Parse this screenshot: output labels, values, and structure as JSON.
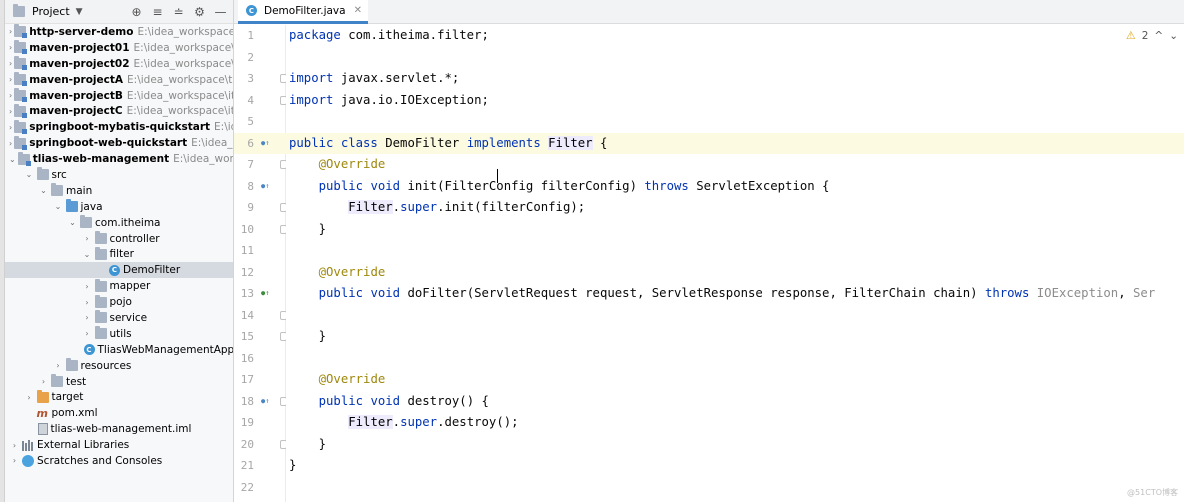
{
  "project_panel": {
    "title": "Project",
    "tree": [
      {
        "label": "http-server-demo",
        "path": "E:\\idea_workspace\\ithe",
        "type": "module",
        "indent": 0,
        "arrow": "›",
        "bold": true
      },
      {
        "label": "maven-project01",
        "path": "E:\\idea_workspace\\ith",
        "type": "module",
        "indent": 0,
        "arrow": "›",
        "bold": true
      },
      {
        "label": "maven-project02",
        "path": "E:\\idea_workspace\\ithe",
        "type": "module",
        "indent": 0,
        "arrow": "›",
        "bold": true
      },
      {
        "label": "maven-projectA",
        "path": "E:\\idea_workspace\\thei",
        "type": "module",
        "indent": 0,
        "arrow": "›",
        "bold": true
      },
      {
        "label": "maven-projectB",
        "path": "E:\\idea_workspace\\ithei",
        "type": "module",
        "indent": 0,
        "arrow": "›",
        "bold": true
      },
      {
        "label": "maven-projectC",
        "path": "E:\\idea_workspace\\ithei",
        "type": "module",
        "indent": 0,
        "arrow": "›",
        "bold": true
      },
      {
        "label": "springboot-mybatis-quickstart",
        "path": "E:\\idea_w",
        "type": "module",
        "indent": 0,
        "arrow": "›",
        "bold": true
      },
      {
        "label": "springboot-web-quickstart",
        "path": "E:\\idea_work",
        "type": "module",
        "indent": 0,
        "arrow": "›",
        "bold": true
      },
      {
        "label": "tlias-web-management",
        "path": "E:\\idea_workspa",
        "type": "module",
        "indent": 0,
        "arrow": "⌄",
        "bold": true
      },
      {
        "label": "src",
        "path": "",
        "type": "folder",
        "indent": 1,
        "arrow": "⌄",
        "bold": false
      },
      {
        "label": "main",
        "path": "",
        "type": "folder",
        "indent": 2,
        "arrow": "⌄",
        "bold": false
      },
      {
        "label": "java",
        "path": "",
        "type": "folder-blue",
        "indent": 3,
        "arrow": "⌄",
        "bold": false
      },
      {
        "label": "com.itheima",
        "path": "",
        "type": "folder",
        "indent": 4,
        "arrow": "⌄",
        "bold": false
      },
      {
        "label": "controller",
        "path": "",
        "type": "folder",
        "indent": 5,
        "arrow": "›",
        "bold": false
      },
      {
        "label": "filter",
        "path": "",
        "type": "folder",
        "indent": 5,
        "arrow": "⌄",
        "bold": false
      },
      {
        "label": "DemoFilter",
        "path": "",
        "type": "class",
        "indent": 6,
        "arrow": "",
        "bold": false,
        "selected": true
      },
      {
        "label": "mapper",
        "path": "",
        "type": "folder",
        "indent": 5,
        "arrow": "›",
        "bold": false
      },
      {
        "label": "pojo",
        "path": "",
        "type": "folder",
        "indent": 5,
        "arrow": "›",
        "bold": false
      },
      {
        "label": "service",
        "path": "",
        "type": "folder",
        "indent": 5,
        "arrow": "›",
        "bold": false
      },
      {
        "label": "utils",
        "path": "",
        "type": "folder",
        "indent": 5,
        "arrow": "›",
        "bold": false
      },
      {
        "label": "TliasWebManagementApp",
        "path": "",
        "type": "class",
        "indent": 5,
        "arrow": "",
        "bold": false
      },
      {
        "label": "resources",
        "path": "",
        "type": "folder",
        "indent": 3,
        "arrow": "›",
        "bold": false
      },
      {
        "label": "test",
        "path": "",
        "type": "folder",
        "indent": 2,
        "arrow": "›",
        "bold": false
      },
      {
        "label": "target",
        "path": "",
        "type": "folder-orange",
        "indent": 1,
        "arrow": "›",
        "bold": false
      },
      {
        "label": "pom.xml",
        "path": "",
        "type": "maven",
        "indent": 1,
        "arrow": "",
        "bold": false
      },
      {
        "label": "tlias-web-management.iml",
        "path": "",
        "type": "iml",
        "indent": 1,
        "arrow": "",
        "bold": false
      },
      {
        "label": "External Libraries",
        "path": "",
        "type": "libs",
        "indent": 0,
        "arrow": "›",
        "bold": false
      },
      {
        "label": "Scratches and Consoles",
        "path": "",
        "type": "scratch",
        "indent": 0,
        "arrow": "›",
        "bold": false
      }
    ]
  },
  "editor": {
    "tab_label": "DemoFilter.java",
    "warnings_count": "2",
    "caret_line": 7,
    "lines": [
      {
        "n": "1",
        "html": "<span class='kw'>package</span> com.itheima.filter;"
      },
      {
        "n": "2",
        "html": ""
      },
      {
        "n": "3",
        "html": "<span class='kw'>import</span> javax.servlet.*;"
      },
      {
        "n": "4",
        "html": "<span class='kw'>import</span> java.io.IOException;"
      },
      {
        "n": "5",
        "html": ""
      },
      {
        "n": "6",
        "html": "<span class='kw'>public class</span> DemoFilter <span class='kw'>implements</span> <span class='ityp'>Filter</span> {",
        "highlight": true,
        "mark": "impl"
      },
      {
        "n": "7",
        "html": "    <span class='an'>@Override</span>"
      },
      {
        "n": "8",
        "html": "    <span class='kw'>public void</span> init(FilterConfig filterConfig) <span class='kw'>throws</span> ServletException {",
        "mark": "impl"
      },
      {
        "n": "9",
        "html": "        <span class='ityp'>Filter</span>.<span class='kw'>super</span>.init(filterConfig);"
      },
      {
        "n": "10",
        "html": "    }"
      },
      {
        "n": "11",
        "html": ""
      },
      {
        "n": "12",
        "html": "    <span class='an'>@Override</span>"
      },
      {
        "n": "13",
        "html": "    <span class='kw'>public void</span> doFilter(ServletRequest request, ServletResponse response, FilterChain chain) <span class='kw'>throws</span> <span class='gr'>IOException</span>, <span class='gr'>Ser</span>",
        "mark": "over"
      },
      {
        "n": "14",
        "html": ""
      },
      {
        "n": "15",
        "html": "    }"
      },
      {
        "n": "16",
        "html": ""
      },
      {
        "n": "17",
        "html": "    <span class='an'>@Override</span>"
      },
      {
        "n": "18",
        "html": "    <span class='kw'>public void</span> destroy() {",
        "mark": "impl"
      },
      {
        "n": "19",
        "html": "        <span class='ityp'>Filter</span>.<span class='kw'>super</span>.destroy();"
      },
      {
        "n": "20",
        "html": "    }"
      },
      {
        "n": "21",
        "html": "}"
      },
      {
        "n": "22",
        "html": ""
      }
    ]
  },
  "watermark": "@51CTO博客",
  "colors": {
    "accent": "#4083c9",
    "keyword": "#0033b3",
    "annotation": "#9e880d",
    "selection": "#d5d9e0"
  }
}
